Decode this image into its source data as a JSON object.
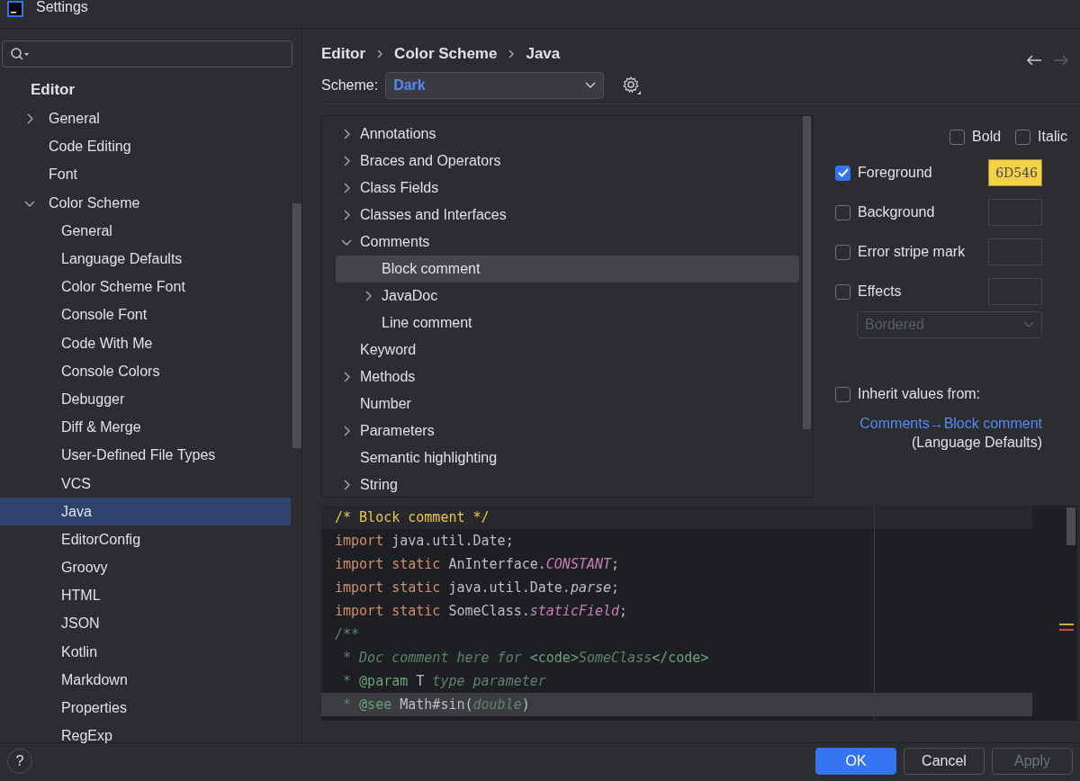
{
  "window": {
    "title": "Settings"
  },
  "sidebar": {
    "heading": "Editor",
    "items": [
      {
        "label": "General",
        "expanded": false,
        "selected": false
      },
      {
        "label": "Code Editing",
        "selected": false
      },
      {
        "label": "Font",
        "selected": false
      },
      {
        "label": "Color Scheme",
        "expanded": true,
        "selected": false,
        "children": [
          {
            "label": "General",
            "selected": false
          },
          {
            "label": "Language Defaults",
            "selected": false
          },
          {
            "label": "Color Scheme Font",
            "selected": false
          },
          {
            "label": "Console Font",
            "selected": false
          },
          {
            "label": "Code With Me",
            "selected": false
          },
          {
            "label": "Console Colors",
            "selected": false
          },
          {
            "label": "Debugger",
            "selected": false
          },
          {
            "label": "Diff & Merge",
            "selected": false
          },
          {
            "label": "User-Defined File Types",
            "selected": false
          },
          {
            "label": "VCS",
            "selected": false
          },
          {
            "label": "Java",
            "selected": true
          },
          {
            "label": "EditorConfig",
            "selected": false
          },
          {
            "label": "Groovy",
            "selected": false
          },
          {
            "label": "HTML",
            "selected": false
          },
          {
            "label": "JSON",
            "selected": false
          },
          {
            "label": "Kotlin",
            "selected": false
          },
          {
            "label": "Markdown",
            "selected": false
          },
          {
            "label": "Properties",
            "selected": false
          },
          {
            "label": "RegExp",
            "selected": false
          }
        ]
      }
    ]
  },
  "breadcrumbs": [
    "Editor",
    "Color Scheme",
    "Java"
  ],
  "scheme": {
    "label": "Scheme:",
    "value": "Dark"
  },
  "tree": [
    {
      "label": "Annotations",
      "expanded": false,
      "selected": false
    },
    {
      "label": "Braces and Operators",
      "expanded": false,
      "selected": false
    },
    {
      "label": "Class Fields",
      "expanded": false,
      "selected": false
    },
    {
      "label": "Classes and Interfaces",
      "expanded": false,
      "selected": false
    },
    {
      "label": "Comments",
      "expanded": true,
      "selected": false,
      "children": [
        {
          "label": "Block comment",
          "selected": true
        },
        {
          "label": "JavaDoc",
          "expanded": false,
          "selected": false
        },
        {
          "label": "Line comment",
          "selected": false
        }
      ]
    },
    {
      "label": "Keyword",
      "selected": false
    },
    {
      "label": "Methods",
      "expanded": false,
      "selected": false
    },
    {
      "label": "Number",
      "selected": false
    },
    {
      "label": "Parameters",
      "expanded": false,
      "selected": false
    },
    {
      "label": "Semantic highlighting",
      "selected": false
    },
    {
      "label": "String",
      "expanded": false,
      "selected": false
    }
  ],
  "attributes": {
    "style_options": [
      {
        "label": "Bold",
        "checked": false
      },
      {
        "label": "Italic",
        "checked": false
      }
    ],
    "colors": [
      {
        "label": "Foreground",
        "checked": true,
        "value": "6D546",
        "color": "#f4d34a"
      },
      {
        "label": "Background",
        "checked": false
      },
      {
        "label": "Error stripe mark",
        "checked": false
      },
      {
        "label": "Effects",
        "checked": false
      }
    ],
    "effect_type": {
      "value": "Bordered",
      "disabled": true
    },
    "inherit": {
      "label": "Inherit values from:",
      "checked": false,
      "link": "Comments→Block comment",
      "note": "(Language Defaults)"
    }
  },
  "preview": {
    "lines": [
      {
        "highlighted": true,
        "tokens": [
          {
            "kind": "block",
            "text": "/* Block comment */"
          }
        ]
      },
      {
        "highlighted": false,
        "tokens": [
          {
            "kind": "keyword",
            "text": "import"
          },
          {
            "kind": "plain",
            "text": " java.util.Date;"
          }
        ]
      },
      {
        "highlighted": false,
        "tokens": [
          {
            "kind": "keyword",
            "text": "import static"
          },
          {
            "kind": "plain",
            "text": " AnInterface."
          },
          {
            "kind": "constant",
            "text": "CONSTANT"
          },
          {
            "kind": "plain",
            "text": ";"
          }
        ]
      },
      {
        "highlighted": false,
        "tokens": [
          {
            "kind": "keyword",
            "text": "import static"
          },
          {
            "kind": "plain",
            "text": " java.util.Date."
          },
          {
            "kind": "method",
            "text": "parse"
          },
          {
            "kind": "plain",
            "text": ";"
          }
        ]
      },
      {
        "highlighted": false,
        "tokens": [
          {
            "kind": "keyword",
            "text": "import static"
          },
          {
            "kind": "plain",
            "text": " SomeClass."
          },
          {
            "kind": "constant",
            "text": "staticField"
          },
          {
            "kind": "plain",
            "text": ";"
          }
        ]
      },
      {
        "highlighted": false,
        "tokens": [
          {
            "kind": "doc",
            "text": "/**"
          }
        ]
      },
      {
        "highlighted": false,
        "tokens": [
          {
            "kind": "doc",
            "text": " * Doc comment here for "
          },
          {
            "kind": "doctag",
            "text": "<code>"
          },
          {
            "kind": "doc",
            "text": "SomeClass"
          },
          {
            "kind": "doctag",
            "text": "</code>"
          }
        ]
      },
      {
        "highlighted": false,
        "tokens": [
          {
            "kind": "doc",
            "text": " * "
          },
          {
            "kind": "doctag",
            "text": "@param"
          },
          {
            "kind": "plain",
            "text": " T"
          },
          {
            "kind": "doc",
            "text": " type parameter"
          }
        ]
      },
      {
        "highlighted": false,
        "selected": true,
        "tokens": [
          {
            "kind": "doc",
            "text": " * "
          },
          {
            "kind": "doctag",
            "text": "@see"
          },
          {
            "kind": "plain",
            "text": " Math#sin("
          },
          {
            "kind": "doc",
            "text": "double"
          },
          {
            "kind": "plain",
            "text": ")"
          }
        ]
      }
    ]
  },
  "buttons": [
    {
      "label": "OK",
      "kind": "primary",
      "disabled": false
    },
    {
      "label": "Cancel",
      "kind": "secondary",
      "disabled": false
    },
    {
      "label": "Apply",
      "kind": "secondary",
      "disabled": true
    }
  ],
  "help": "?"
}
